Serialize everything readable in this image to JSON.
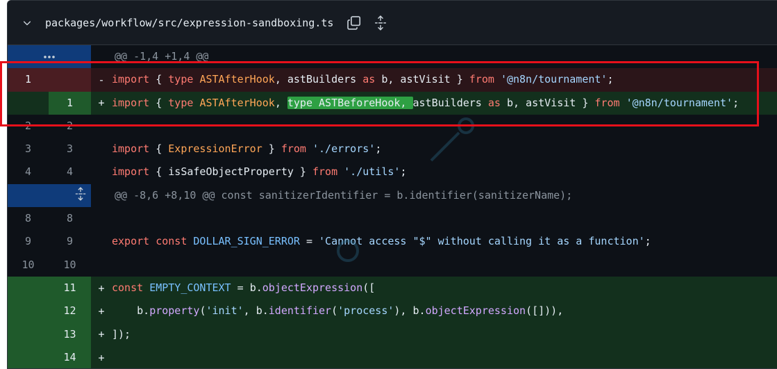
{
  "file": {
    "path": "packages/workflow/src/expression-sandboxing.ts"
  },
  "icons": {
    "collapse": "chevron-down-icon",
    "copy": "copy-icon",
    "expand": "unfold-icon"
  },
  "hunks": [
    {
      "header": "@@ -1,4 +1,4 @@"
    },
    {
      "header": "@@ -8,6 +8,10 @@ const sanitizerIdentifier = b.identifier(sanitizerName);"
    }
  ],
  "lines": {
    "l1_old": {
      "old": "1",
      "new": "",
      "marker": "-"
    },
    "l1_new": {
      "old": "",
      "new": "1",
      "marker": "+"
    },
    "l2": {
      "old": "2",
      "new": "2"
    },
    "l3": {
      "old": "3",
      "new": "3"
    },
    "l4": {
      "old": "4",
      "new": "4"
    },
    "l8": {
      "old": "8",
      "new": "8"
    },
    "l9": {
      "old": "9",
      "new": "9"
    },
    "l10": {
      "old": "10",
      "new": "10"
    },
    "l11": {
      "old": "",
      "new": "11",
      "marker": "+"
    },
    "l12": {
      "old": "",
      "new": "12",
      "marker": "+"
    },
    "l13": {
      "old": "",
      "new": "13",
      "marker": "+"
    },
    "l14": {
      "old": "",
      "new": "14",
      "marker": "+"
    }
  },
  "tokens": {
    "import": "import",
    "lbrace": "{ ",
    "type": "type",
    "ASTAfterHook": "ASTAfterHook",
    "comma_sp": ", ",
    "typeASTBeforeHook": "type ASTBeforeHook, ",
    "astBuilders": "astBuilders",
    "as": "as",
    "b_comma_astVisit": " b, astVisit } ",
    "from": "from",
    "tournament": "'@n8n/tournament'",
    "semi": ";",
    "ExpressionError": "ExpressionError",
    "errors": "'./errors'",
    "isSafeObjectProperty": "isSafeObjectProperty",
    "utils": "'./utils'",
    "rbrace_sp": " } ",
    "export": "export",
    "const": "const",
    "DOLLAR_SIGN_ERROR": "DOLLAR_SIGN_ERROR",
    "eq": " = ",
    "dollar_msg": "'Cannot access \"$\" without calling it as a function'",
    "EMPTY_CONTEXT": "EMPTY_CONTEXT",
    "b_dot": "b.",
    "objectExpression": "objectExpression",
    "open_arr": "([",
    "indent": "    ",
    "property": "property",
    "lparen": "(",
    "init": "'init'",
    "identifier": "identifier",
    "process": "'process'",
    "close_mid": "), ",
    "empty_call": "([])),",
    "close_all": "]);"
  },
  "colors": {
    "accent_red_box": "#e6101b",
    "add_bg": "#13301d",
    "del_bg": "#2b1519",
    "hunk_gutter": "#0f3b7a"
  }
}
